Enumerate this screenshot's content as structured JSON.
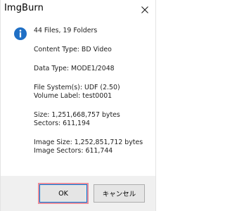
{
  "window": {
    "title": "ImgBurn"
  },
  "icons": {
    "info": "info-icon",
    "close": "close-icon",
    "accent": "#1f6fc5"
  },
  "message": {
    "files_folders": "44 Files, 19 Folders",
    "content_type": "Content Type: BD Video",
    "data_type": "Data Type: MODE1/2048",
    "file_systems": "File System(s): UDF (2.50)",
    "volume_label": "Volume Label: test0001",
    "size": "Size: 1,251,668,757 bytes",
    "sectors": "Sectors: 611,194",
    "image_size": "Image Size: 1,252,851,712 bytes",
    "image_sectors": "Image Sectors: 611,744"
  },
  "buttons": {
    "ok_label": "OK",
    "cancel_label": "キャンセル"
  }
}
